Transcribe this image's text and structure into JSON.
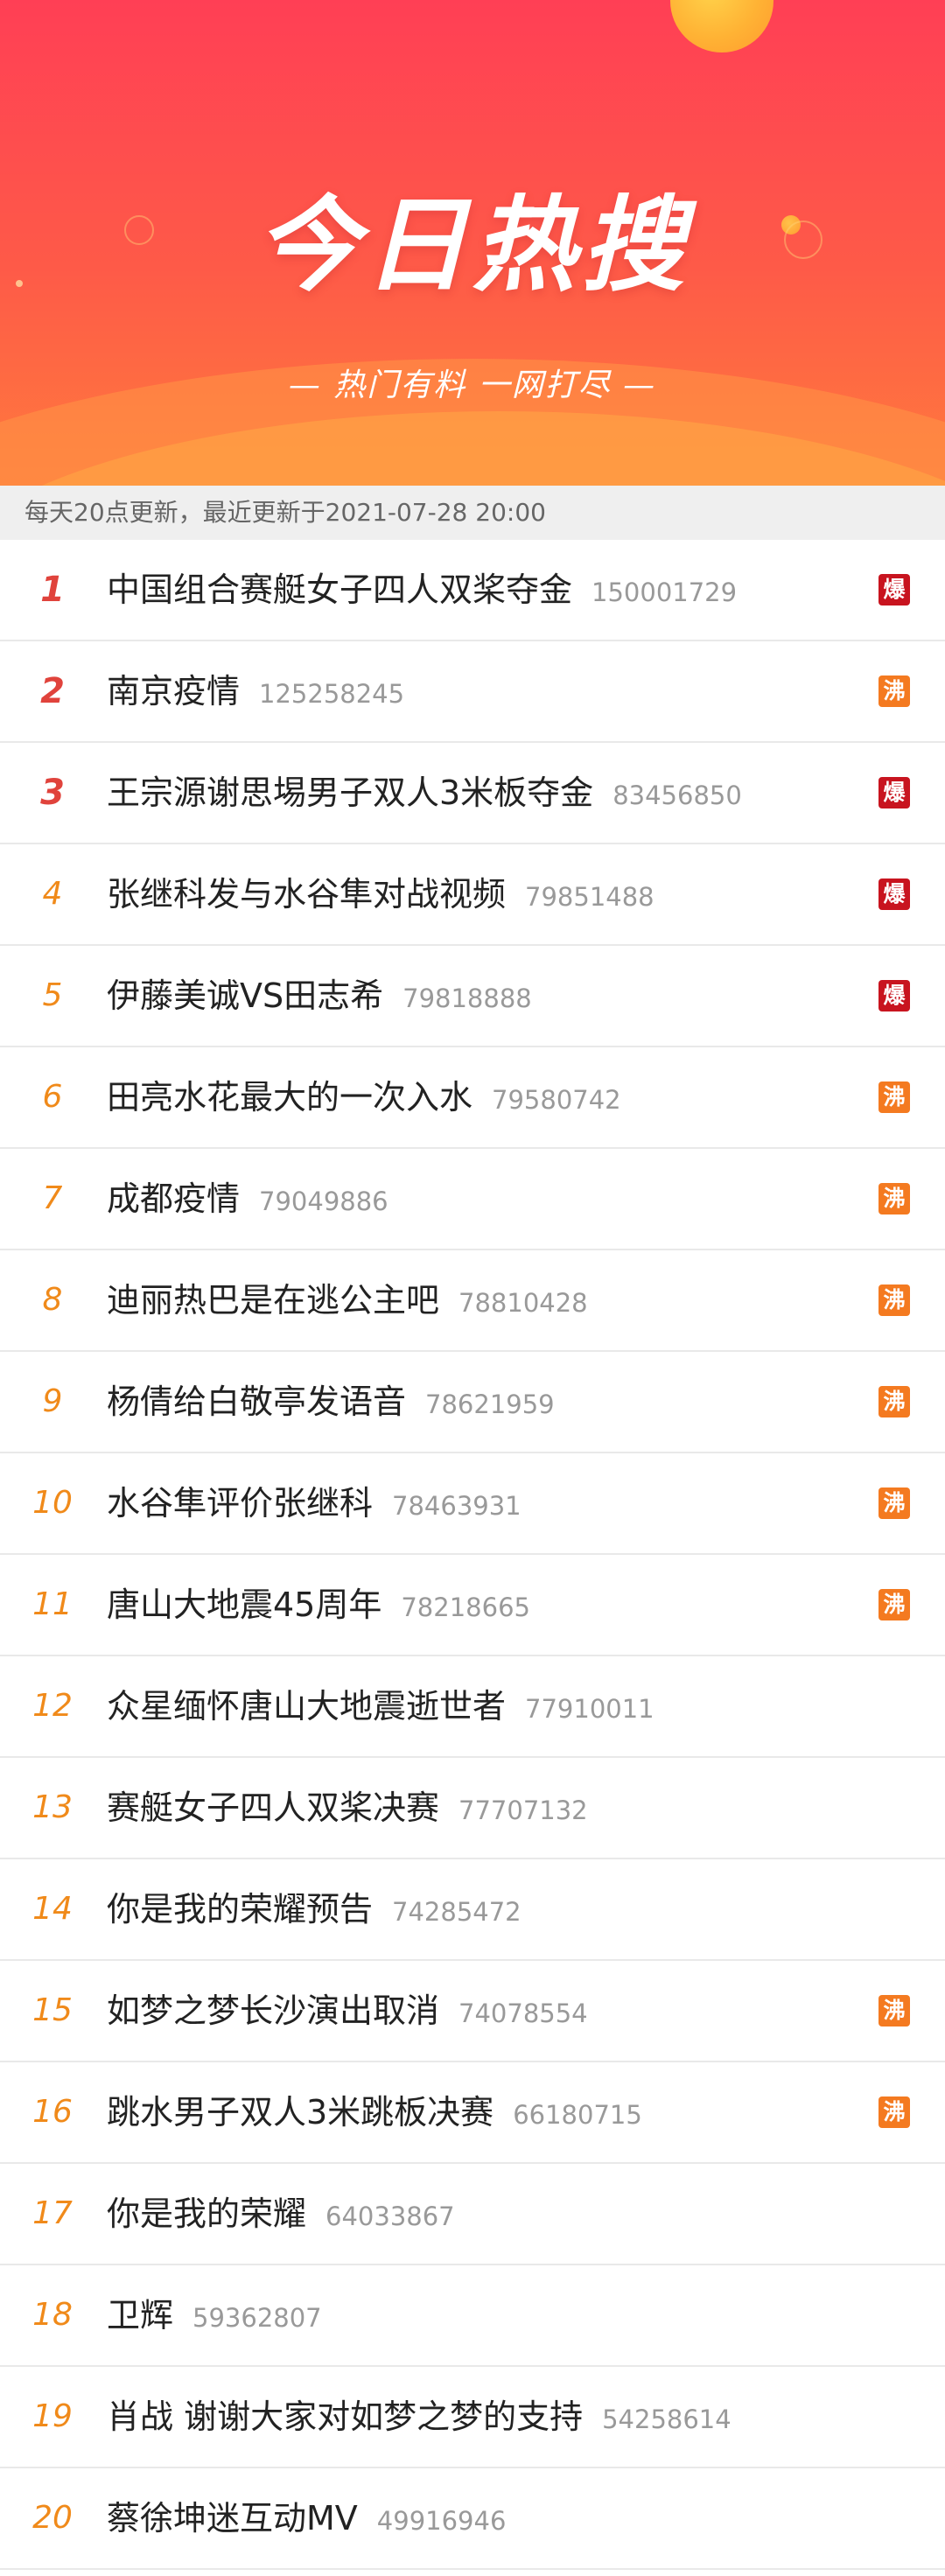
{
  "banner": {
    "title": "今日热搜",
    "subtitle": "— 热门有料 一网打尽 —"
  },
  "notice": "每天20点更新，最近更新于2021-07-28 20:00",
  "colors": {
    "top_rank": "#e0433c",
    "rank": "#f08a1a",
    "badge_bao": "#c8141f",
    "badge_fei": "#f47a20"
  },
  "items": [
    {
      "rank": "1",
      "title": "中国组合赛艇女子四人双桨夺金",
      "count": "150001729",
      "badge": "爆"
    },
    {
      "rank": "2",
      "title": "南京疫情",
      "count": "125258245",
      "badge": "沸"
    },
    {
      "rank": "3",
      "title": "王宗源谢思埸男子双人3米板夺金",
      "count": "83456850",
      "badge": "爆"
    },
    {
      "rank": "4",
      "title": "张继科发与水谷隼对战视频",
      "count": "79851488",
      "badge": "爆"
    },
    {
      "rank": "5",
      "title": "伊藤美诚VS田志希",
      "count": "79818888",
      "badge": "爆"
    },
    {
      "rank": "6",
      "title": "田亮水花最大的一次入水",
      "count": "79580742",
      "badge": "沸"
    },
    {
      "rank": "7",
      "title": "成都疫情",
      "count": "79049886",
      "badge": "沸"
    },
    {
      "rank": "8",
      "title": "迪丽热巴是在逃公主吧",
      "count": "78810428",
      "badge": "沸"
    },
    {
      "rank": "9",
      "title": "杨倩给白敬亭发语音",
      "count": "78621959",
      "badge": "沸"
    },
    {
      "rank": "10",
      "title": "水谷隼评价张继科",
      "count": "78463931",
      "badge": "沸"
    },
    {
      "rank": "11",
      "title": "唐山大地震45周年",
      "count": "78218665",
      "badge": "沸"
    },
    {
      "rank": "12",
      "title": "众星缅怀唐山大地震逝世者",
      "count": "77910011",
      "badge": ""
    },
    {
      "rank": "13",
      "title": "赛艇女子四人双桨决赛",
      "count": "77707132",
      "badge": ""
    },
    {
      "rank": "14",
      "title": "你是我的荣耀预告",
      "count": "74285472",
      "badge": ""
    },
    {
      "rank": "15",
      "title": "如梦之梦长沙演出取消",
      "count": "74078554",
      "badge": "沸"
    },
    {
      "rank": "16",
      "title": "跳水男子双人3米跳板决赛",
      "count": "66180715",
      "badge": "沸"
    },
    {
      "rank": "17",
      "title": "你是我的荣耀",
      "count": "64033867",
      "badge": ""
    },
    {
      "rank": "18",
      "title": "卫辉",
      "count": "59362807",
      "badge": ""
    },
    {
      "rank": "19",
      "title": "肖战 谢谢大家对如梦之梦的支持",
      "count": "54258614",
      "badge": ""
    },
    {
      "rank": "20",
      "title": "蔡徐坤迷互动MV",
      "count": "49916946",
      "badge": ""
    }
  ]
}
